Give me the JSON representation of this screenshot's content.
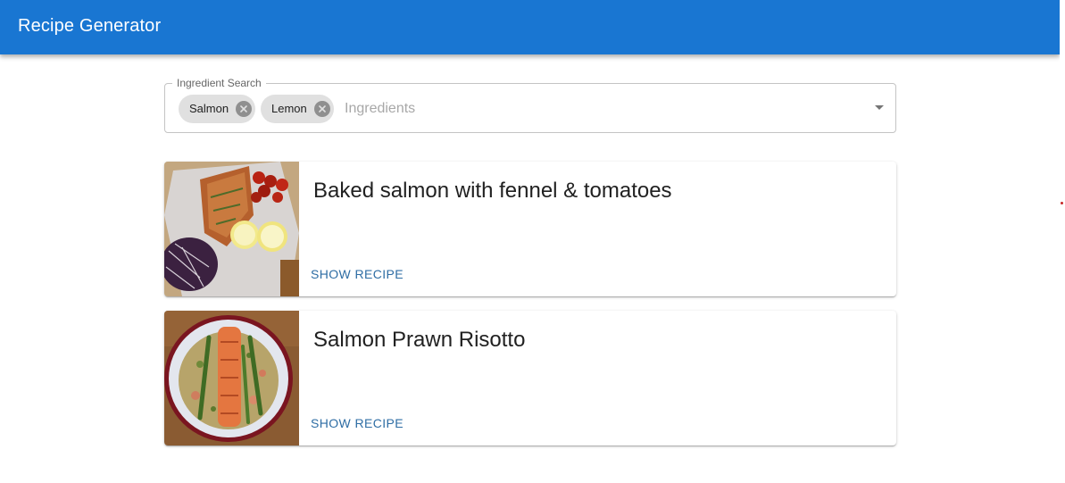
{
  "app": {
    "title": "Recipe Generator",
    "primary_color": "#1976d2"
  },
  "search": {
    "label": "Ingredient Search",
    "placeholder": "Ingredients",
    "chips": [
      {
        "label": "Salmon",
        "delete_icon": "cancel-icon"
      },
      {
        "label": "Lemon",
        "delete_icon": "cancel-icon"
      }
    ],
    "dropdown_icon": "arrow-drop-down-icon"
  },
  "recipes": [
    {
      "title": "Baked salmon with fennel & tomatoes",
      "action_label": "SHOW RECIPE",
      "image": "baked-salmon-photo"
    },
    {
      "title": "Salmon Prawn Risotto",
      "action_label": "SHOW RECIPE",
      "image": "salmon-risotto-photo"
    }
  ],
  "colors": {
    "action_text": "#2e6da4",
    "chip_bg": "#e0e0e0"
  }
}
